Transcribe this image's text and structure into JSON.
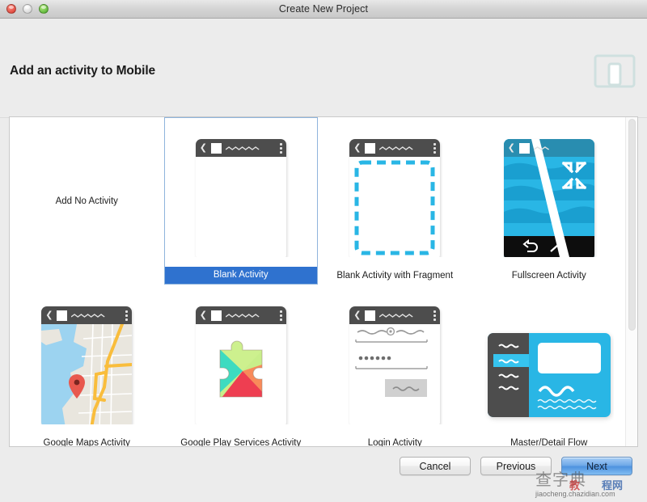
{
  "window": {
    "title": "Create New Project",
    "controls": {
      "close": "close-button",
      "minimize": "minimize-button",
      "zoom": "zoom-button"
    }
  },
  "header": {
    "title": "Add an activity to Mobile",
    "icon": "device-tablet-phone-icon"
  },
  "colors": {
    "selection_blue": "#2f72cf",
    "selection_border": "#8fb4dc",
    "android_cyan": "#29b6e5",
    "appbar_gray": "#4d4d4d",
    "window_bg": "#ececec",
    "panel_bg": "#ffffff"
  },
  "activities": [
    {
      "id": "add-no-activity",
      "label": "Add No Activity",
      "selected": false,
      "thumb": "none"
    },
    {
      "id": "blank-activity",
      "label": "Blank Activity",
      "selected": true,
      "thumb": "blank"
    },
    {
      "id": "blank-activity-fragment",
      "label": "Blank Activity with Fragment",
      "selected": false,
      "thumb": "fragment"
    },
    {
      "id": "fullscreen-activity",
      "label": "Fullscreen Activity",
      "selected": false,
      "thumb": "fullscreen"
    },
    {
      "id": "google-maps-activity",
      "label": "Google Maps Activity",
      "selected": false,
      "thumb": "maps"
    },
    {
      "id": "google-play-services-activity",
      "label": "Google Play Services Activity",
      "selected": false,
      "thumb": "play"
    },
    {
      "id": "login-activity",
      "label": "Login Activity",
      "selected": false,
      "thumb": "login"
    },
    {
      "id": "master-detail-flow",
      "label": "Master/Detail Flow",
      "selected": false,
      "thumb": "masterdetail"
    }
  ],
  "scrollbar": {
    "name": "vertical-scrollbar",
    "thumb_fraction": "0.64"
  },
  "footer": {
    "cancel_label": "Cancel",
    "previous_label": "Previous",
    "next_label": "Next"
  },
  "watermark": {
    "cn": "查字典",
    "red": "教",
    "blue": "程网",
    "url": "jiaocheng.chazidian.com"
  }
}
